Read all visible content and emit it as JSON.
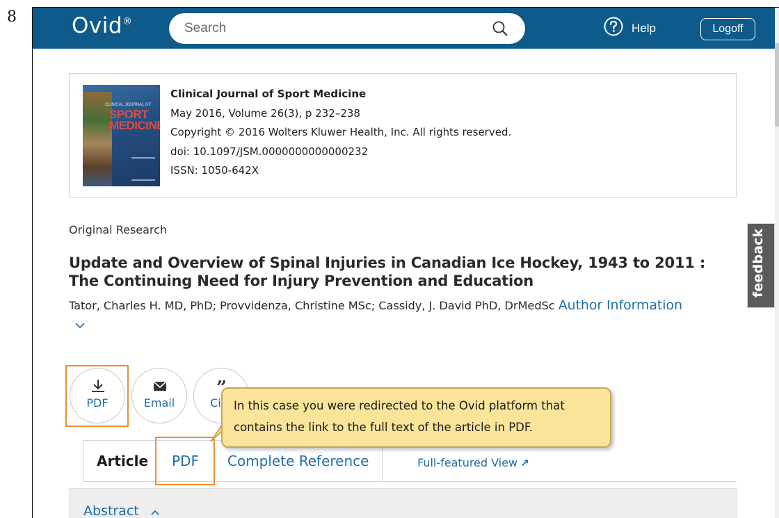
{
  "step_number": "8",
  "header": {
    "logo_text": "Ovid",
    "logo_mark": "®",
    "search_placeholder": "Search",
    "help_label": "Help",
    "logoff_label": "Logoff",
    "bg_color": "#0e5a8a"
  },
  "journal": {
    "name": "Clinical Journal of Sport Medicine",
    "issue": "May 2016, Volume 26(3), p 232–238",
    "copyright": "Copyright © 2016 Wolters Kluwer Health, Inc. All rights reserved.",
    "doi": "doi: 10.1097/JSM.0000000000000232",
    "issn": "ISSN: 1050-642X",
    "cover_small_text": "CLINICAL JOURNAL OF",
    "cover_title_1": "SPORT",
    "cover_title_2": "MEDICINE"
  },
  "article": {
    "type": "Original Research",
    "title": "Update and Overview of Spinal Injuries in Canadian Ice Hockey, 1943 to 2011 : The Continuing Need for Injury Prevention and Education",
    "authors": "Tator, Charles H. MD, PhD; Provvidenza, Christine MSc; Cassidy, J. David PhD, DrMedSc",
    "author_info_link": "Author Information"
  },
  "actions": {
    "pdf": "PDF",
    "email": "Email",
    "cite": "Cite"
  },
  "tabs": {
    "article": "Article",
    "pdf": "PDF",
    "complete_reference": "Complete Reference",
    "full_featured_view": "Full-featured View",
    "external_arrow": "↗"
  },
  "abstract": {
    "label": "Abstract"
  },
  "tooltip": {
    "text": "In this case you were redirected to the Ovid platform that contains the link to the full text of the article in PDF."
  },
  "feedback": {
    "label": "feedback"
  },
  "colors": {
    "link": "#1f6da6",
    "highlight": "#f28a30",
    "tooltip_bg": "#fae49a"
  }
}
